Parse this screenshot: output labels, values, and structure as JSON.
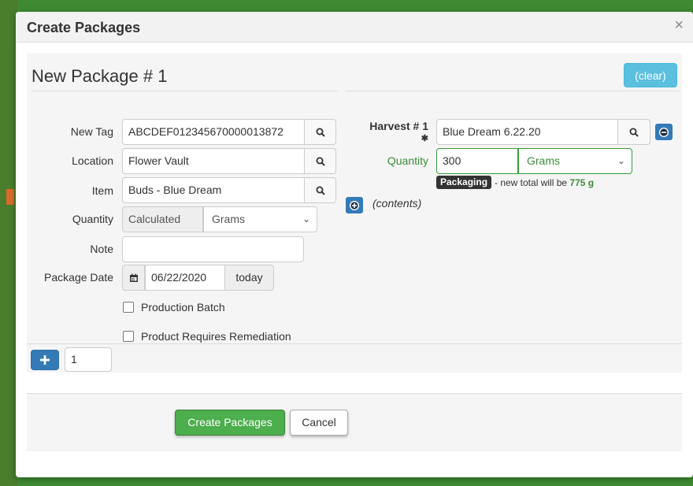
{
  "modal": {
    "title": "Create Packages",
    "close_icon": "close-icon"
  },
  "package": {
    "heading": "New Package # 1",
    "clear_label": "(clear)",
    "new_tag": {
      "label": "New Tag",
      "value": "ABCDEF012345670000013872"
    },
    "location": {
      "label": "Location",
      "value": "Flower Vault"
    },
    "item": {
      "label": "Item",
      "value": "Buds - Blue Dream"
    },
    "quantity": {
      "label": "Quantity",
      "value": "Calculated",
      "unit": "Grams"
    },
    "note": {
      "label": "Note",
      "value": ""
    },
    "package_date": {
      "label": "Package Date",
      "value": "06/22/2020",
      "today_label": "today"
    },
    "production_batch_label": "Production Batch",
    "remediation_label": "Product Requires Remediation"
  },
  "harvest": {
    "label": "Harvest # 1",
    "required_marker": "✱",
    "value": "Blue Dream 6.22.20",
    "quantity_label": "Quantity",
    "quantity_value": "300",
    "quantity_unit": "Grams",
    "badge": "Packaging",
    "note_prefix": "- new total will be",
    "new_total": "775 g",
    "contents_label": "(contents)"
  },
  "bottom": {
    "count_value": "1"
  },
  "footer": {
    "create_label": "Create Packages",
    "cancel_label": "Cancel"
  },
  "colors": {
    "accent_blue": "#337ab7",
    "info_blue": "#5bc0de",
    "success_green": "#4cae4c",
    "field_green": "#3c8c3a"
  }
}
